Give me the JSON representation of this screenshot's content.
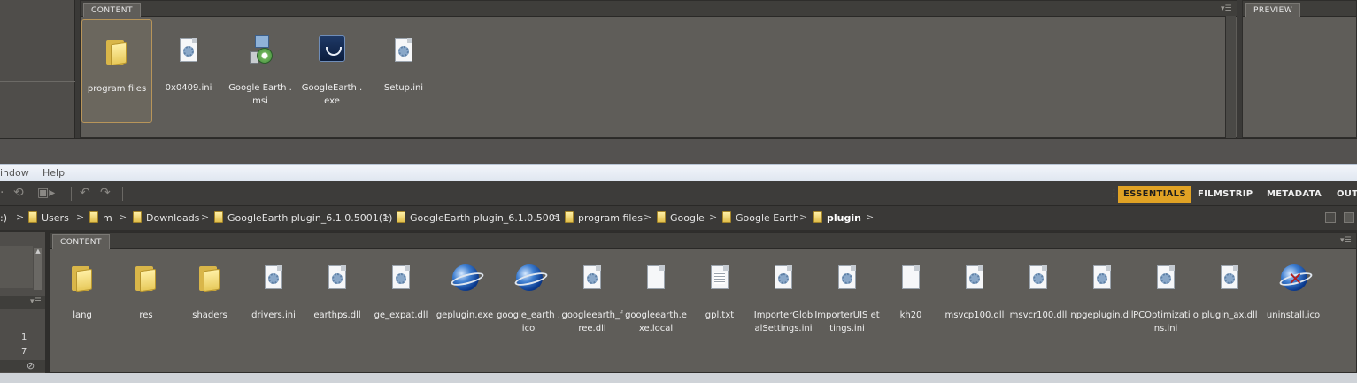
{
  "top": {
    "content_tab": "CONTENT",
    "preview_tab": "PREVIEW",
    "files": [
      {
        "label": "program files",
        "icon": "folder-icon",
        "selected": true
      },
      {
        "label": "0x0409.ini",
        "icon": "settings-file-icon"
      },
      {
        "label": "Google Earth .msi",
        "icon": "installer-icon"
      },
      {
        "label": "GoogleEarth .exe",
        "icon": "google-earth-exe-icon"
      },
      {
        "label": "Setup.ini",
        "icon": "settings-file-icon"
      }
    ]
  },
  "menu": {
    "items": [
      "indow",
      "Help"
    ]
  },
  "workspaces": {
    "items": [
      "ESSENTIALS",
      "FILMSTRIP",
      "METADATA",
      "OUT"
    ],
    "active": "ESSENTIALS",
    "active_color": "#e0a224"
  },
  "breadcrumb": {
    "items": [
      ":)",
      "Users",
      "m",
      "Downloads",
      "GoogleEarth plugin_6.1.0.5001(1)",
      "GoogleEarth plugin_6.1.0.5001",
      "program files",
      "Google",
      "Google Earth",
      "plugin"
    ],
    "current": "plugin"
  },
  "left_panel": {
    "row_numbers": [
      "1",
      "7"
    ]
  },
  "bottom": {
    "content_tab": "CONTENT",
    "files": [
      {
        "label": "lang",
        "icon": "folder-icon"
      },
      {
        "label": "res",
        "icon": "folder-icon"
      },
      {
        "label": "shaders",
        "icon": "folder-icon"
      },
      {
        "label": "drivers.ini",
        "icon": "settings-file-icon"
      },
      {
        "label": "earthps.dll",
        "icon": "settings-file-icon"
      },
      {
        "label": "ge_expat.dll",
        "icon": "settings-file-icon"
      },
      {
        "label": "geplugin.exe",
        "icon": "globe-icon"
      },
      {
        "label": "google_earth .ico",
        "icon": "globe-icon"
      },
      {
        "label": "googleearth_f ree.dll",
        "icon": "settings-file-icon"
      },
      {
        "label": "googleearth.e xe.local",
        "icon": "blank-file-icon"
      },
      {
        "label": "gpl.txt",
        "icon": "text-file-icon"
      },
      {
        "label": "ImporterGlob alSettings.ini",
        "icon": "settings-file-icon"
      },
      {
        "label": "ImporterUIS ettings.ini",
        "icon": "settings-file-icon"
      },
      {
        "label": "kh20",
        "icon": "blank-file-icon"
      },
      {
        "label": "msvcp100.dll",
        "icon": "settings-file-icon"
      },
      {
        "label": "msvcr100.dll",
        "icon": "settings-file-icon"
      },
      {
        "label": "npgeplugin.dll",
        "icon": "settings-file-icon"
      },
      {
        "label": "PCOptimizati ons.ini",
        "icon": "settings-file-icon"
      },
      {
        "label": "plugin_ax.dll",
        "icon": "settings-file-icon"
      },
      {
        "label": "uninstall.ico",
        "icon": "uninstall-globe-icon"
      }
    ]
  },
  "colors": {
    "panel_bg": "#5f5d59",
    "selection_border": "#b8955a",
    "accent": "#e0a224"
  }
}
